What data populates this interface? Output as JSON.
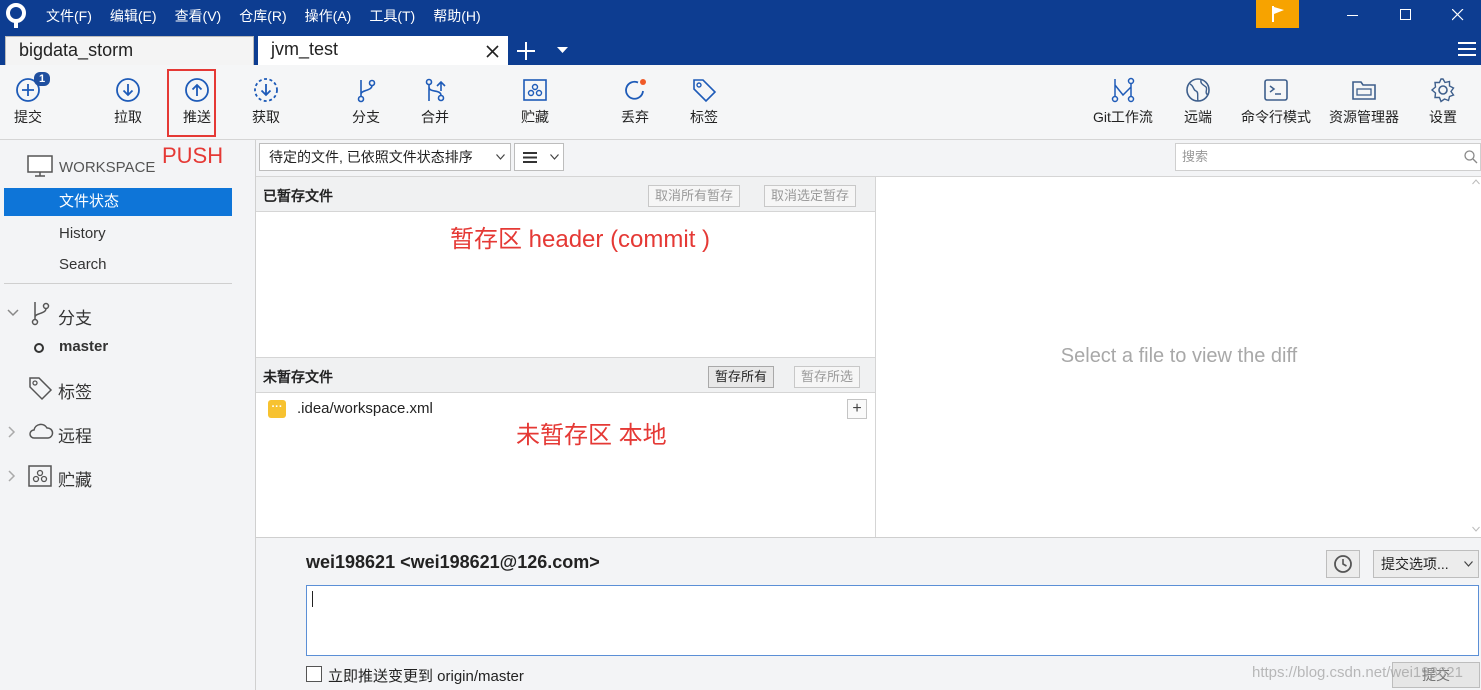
{
  "titlebar": {
    "menu": [
      "文件(F)",
      "编辑(E)",
      "查看(V)",
      "仓库(R)",
      "操作(A)",
      "工具(T)",
      "帮助(H)"
    ],
    "accent": "#0d3d91",
    "flag_color": "#f7a300"
  },
  "tabs": [
    {
      "label": "bigdata_storm",
      "active": false
    },
    {
      "label": "jvm_test",
      "active": true
    }
  ],
  "toolbar": {
    "commit": {
      "label": "提交",
      "badge": "1",
      "icon": "plus-circle-icon"
    },
    "pull": {
      "label": "拉取",
      "icon": "arrow-down-circle-icon"
    },
    "push": {
      "label": "推送",
      "icon": "arrow-up-circle-icon"
    },
    "fetch": {
      "label": "获取",
      "icon": "dashed-arrow-down-circle-icon"
    },
    "branch": {
      "label": "分支",
      "icon": "branch-icon"
    },
    "merge": {
      "label": "合并",
      "icon": "merge-icon"
    },
    "stash": {
      "label": "贮藏",
      "icon": "stash-icon"
    },
    "discard": {
      "label": "丢弃",
      "icon": "discard-icon"
    },
    "tag": {
      "label": "标签",
      "icon": "tag-icon"
    },
    "gitflow": {
      "label": "Git工作流",
      "icon": "gitflow-icon"
    },
    "remote": {
      "label": "远端",
      "icon": "globe-icon"
    },
    "terminal": {
      "label": "命令行模式",
      "icon": "terminal-icon"
    },
    "explorer": {
      "label": "资源管理器",
      "icon": "folder-icon"
    },
    "settings": {
      "label": "设置",
      "icon": "gear-icon"
    }
  },
  "annotations": {
    "push": "PUSH",
    "staged": "暂存区 header    (commit )",
    "unstaged": "未暂存区    本地"
  },
  "sidebar": {
    "workspace": "WORKSPACE",
    "items": [
      {
        "label": "文件状态",
        "selected": true
      },
      {
        "label": "History",
        "selected": false
      },
      {
        "label": "Search",
        "selected": false
      }
    ],
    "branches": "分支",
    "current_branch": "master",
    "tags": "标签",
    "remotes": "远程",
    "stashes": "贮藏"
  },
  "filterbar": {
    "sort_select": "待定的文件, 已依照文件状态排序",
    "search_placeholder": "搜索"
  },
  "staged": {
    "title": "已暂存文件",
    "unstage_all": "取消所有暂存",
    "unstage_selected": "取消选定暂存"
  },
  "unstaged": {
    "title": "未暂存文件",
    "stage_all": "暂存所有",
    "stage_selected": "暂存所选",
    "files": [
      {
        "name": ".idea/workspace.xml",
        "status": "modified"
      }
    ]
  },
  "diff": {
    "placeholder": "Select a file to view the diff"
  },
  "commit": {
    "author": "wei198621 <wei198621@126.com>",
    "options": "提交选项...",
    "message": "",
    "push_immediately": "立即推送变更到 origin/master",
    "commit_button": "提交",
    "watermark": "https://blog.csdn.net/wei198621"
  }
}
